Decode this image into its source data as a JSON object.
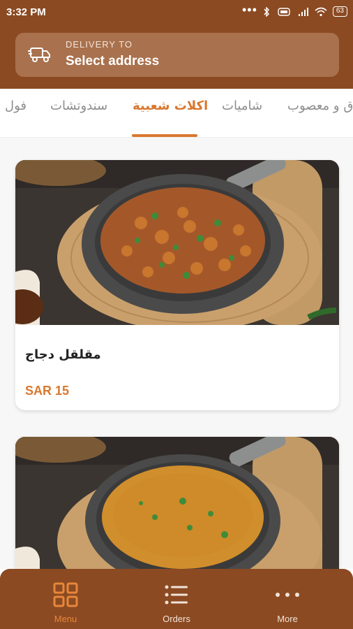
{
  "status_bar": {
    "time": "3:32 PM",
    "battery": "63"
  },
  "delivery": {
    "label": "DELIVERY TO",
    "address": "Select address"
  },
  "tabs": [
    {
      "label": "ق و معصوب"
    },
    {
      "label": "شاميات"
    },
    {
      "label": "اكلات شعبية",
      "active": true
    },
    {
      "label": "سندوتشات"
    },
    {
      "label": "فول"
    }
  ],
  "items": [
    {
      "name": "مقلقل دجاج",
      "price": "SAR 15"
    },
    {
      "name": "",
      "price": ""
    }
  ],
  "bottom_nav": [
    {
      "label": "Menu",
      "icon": "grid-icon",
      "active": true
    },
    {
      "label": "Orders",
      "icon": "list-icon"
    },
    {
      "label": "More",
      "icon": "more-dots-icon"
    }
  ],
  "colors": {
    "brand": "#8b4a22",
    "accent": "#d9782f",
    "address_box": "#a9714d"
  }
}
